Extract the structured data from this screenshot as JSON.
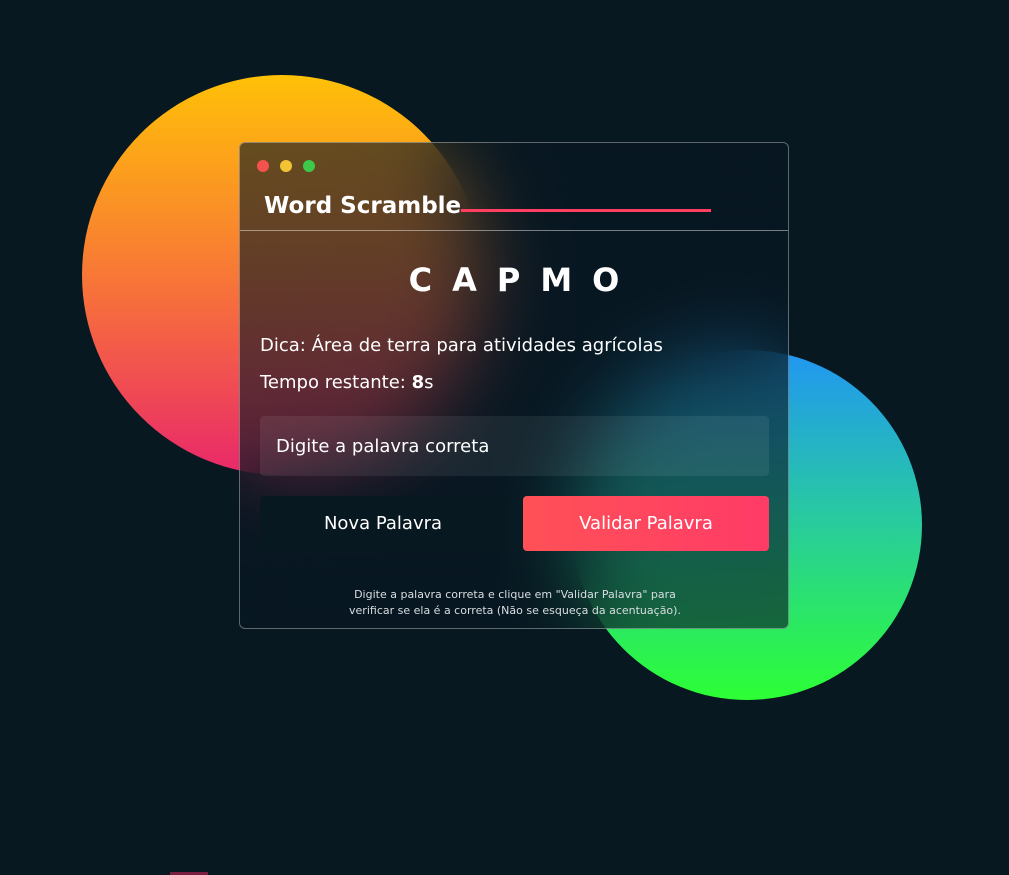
{
  "app": {
    "title": "Word Scramble"
  },
  "game": {
    "scrambled_word": "CAPMO",
    "hint_label": "Dica:",
    "hint_text": "Área de terra para atividades agrícolas",
    "timer_label": "Tempo restante:",
    "timer_value": "8",
    "timer_unit": "s"
  },
  "input": {
    "placeholder": "Digite a palavra correta",
    "value": ""
  },
  "buttons": {
    "new_word": "Nova Palavra",
    "validate": "Validar Palavra"
  },
  "footer": {
    "line1": "Digite a palavra correta e clique em \"Validar Palavra\" para",
    "line2": "verificar se ela é a correta (Não se esqueça da acentuação)."
  },
  "colors": {
    "background": "#071821",
    "accent": "#ff3e62",
    "circle_orange_top": "#ffc107",
    "circle_orange_bottom": "#e9286a",
    "circle_green_top": "#2196f3",
    "circle_green_bottom": "#2dff35"
  },
  "icons": [
    "close-dot",
    "minimize-dot",
    "maximize-dot"
  ]
}
